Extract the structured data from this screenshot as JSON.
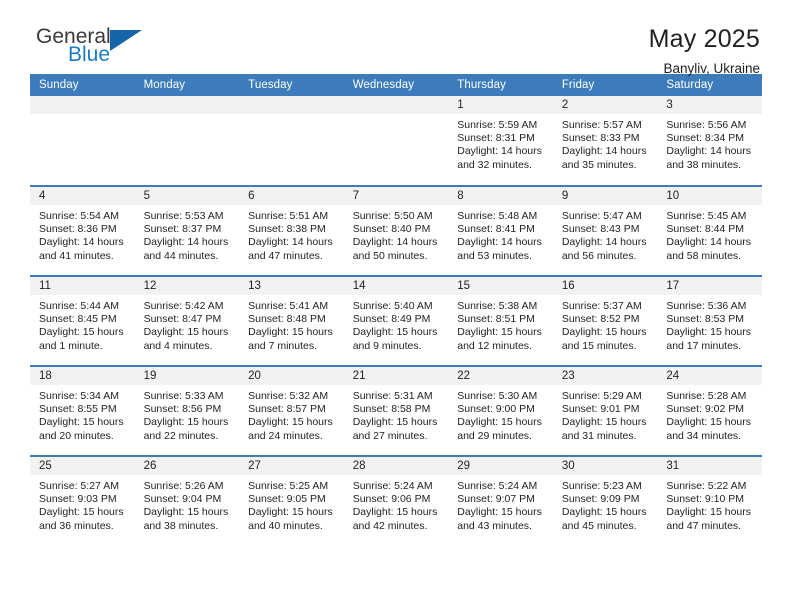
{
  "brand": {
    "name_top": "General",
    "name_bottom": "Blue",
    "flag_icon": "triangle-flag-icon",
    "accent_color": "#1d7dc4"
  },
  "header": {
    "title": "May 2025",
    "location": "Banyliv, Ukraine"
  },
  "theme": {
    "header_bg": "#3d7cba",
    "header_text": "#ffffff",
    "daynum_bg": "#f2f2f2",
    "cell_bg": "#ffffff",
    "text": "#231f20"
  },
  "weekday_headers": [
    "Sunday",
    "Monday",
    "Tuesday",
    "Wednesday",
    "Thursday",
    "Friday",
    "Saturday"
  ],
  "weeks": [
    [
      {
        "day": "",
        "sunrise": "",
        "sunset": "",
        "daylight": "",
        "daylight2": ""
      },
      {
        "day": "",
        "sunrise": "",
        "sunset": "",
        "daylight": "",
        "daylight2": ""
      },
      {
        "day": "",
        "sunrise": "",
        "sunset": "",
        "daylight": "",
        "daylight2": ""
      },
      {
        "day": "",
        "sunrise": "",
        "sunset": "",
        "daylight": "",
        "daylight2": ""
      },
      {
        "day": "1",
        "sunrise": "Sunrise: 5:59 AM",
        "sunset": "Sunset: 8:31 PM",
        "daylight": "Daylight: 14 hours",
        "daylight2": "and 32 minutes."
      },
      {
        "day": "2",
        "sunrise": "Sunrise: 5:57 AM",
        "sunset": "Sunset: 8:33 PM",
        "daylight": "Daylight: 14 hours",
        "daylight2": "and 35 minutes."
      },
      {
        "day": "3",
        "sunrise": "Sunrise: 5:56 AM",
        "sunset": "Sunset: 8:34 PM",
        "daylight": "Daylight: 14 hours",
        "daylight2": "and 38 minutes."
      }
    ],
    [
      {
        "day": "4",
        "sunrise": "Sunrise: 5:54 AM",
        "sunset": "Sunset: 8:36 PM",
        "daylight": "Daylight: 14 hours",
        "daylight2": "and 41 minutes."
      },
      {
        "day": "5",
        "sunrise": "Sunrise: 5:53 AM",
        "sunset": "Sunset: 8:37 PM",
        "daylight": "Daylight: 14 hours",
        "daylight2": "and 44 minutes."
      },
      {
        "day": "6",
        "sunrise": "Sunrise: 5:51 AM",
        "sunset": "Sunset: 8:38 PM",
        "daylight": "Daylight: 14 hours",
        "daylight2": "and 47 minutes."
      },
      {
        "day": "7",
        "sunrise": "Sunrise: 5:50 AM",
        "sunset": "Sunset: 8:40 PM",
        "daylight": "Daylight: 14 hours",
        "daylight2": "and 50 minutes."
      },
      {
        "day": "8",
        "sunrise": "Sunrise: 5:48 AM",
        "sunset": "Sunset: 8:41 PM",
        "daylight": "Daylight: 14 hours",
        "daylight2": "and 53 minutes."
      },
      {
        "day": "9",
        "sunrise": "Sunrise: 5:47 AM",
        "sunset": "Sunset: 8:43 PM",
        "daylight": "Daylight: 14 hours",
        "daylight2": "and 56 minutes."
      },
      {
        "day": "10",
        "sunrise": "Sunrise: 5:45 AM",
        "sunset": "Sunset: 8:44 PM",
        "daylight": "Daylight: 14 hours",
        "daylight2": "and 58 minutes."
      }
    ],
    [
      {
        "day": "11",
        "sunrise": "Sunrise: 5:44 AM",
        "sunset": "Sunset: 8:45 PM",
        "daylight": "Daylight: 15 hours",
        "daylight2": "and 1 minute."
      },
      {
        "day": "12",
        "sunrise": "Sunrise: 5:42 AM",
        "sunset": "Sunset: 8:47 PM",
        "daylight": "Daylight: 15 hours",
        "daylight2": "and 4 minutes."
      },
      {
        "day": "13",
        "sunrise": "Sunrise: 5:41 AM",
        "sunset": "Sunset: 8:48 PM",
        "daylight": "Daylight: 15 hours",
        "daylight2": "and 7 minutes."
      },
      {
        "day": "14",
        "sunrise": "Sunrise: 5:40 AM",
        "sunset": "Sunset: 8:49 PM",
        "daylight": "Daylight: 15 hours",
        "daylight2": "and 9 minutes."
      },
      {
        "day": "15",
        "sunrise": "Sunrise: 5:38 AM",
        "sunset": "Sunset: 8:51 PM",
        "daylight": "Daylight: 15 hours",
        "daylight2": "and 12 minutes."
      },
      {
        "day": "16",
        "sunrise": "Sunrise: 5:37 AM",
        "sunset": "Sunset: 8:52 PM",
        "daylight": "Daylight: 15 hours",
        "daylight2": "and 15 minutes."
      },
      {
        "day": "17",
        "sunrise": "Sunrise: 5:36 AM",
        "sunset": "Sunset: 8:53 PM",
        "daylight": "Daylight: 15 hours",
        "daylight2": "and 17 minutes."
      }
    ],
    [
      {
        "day": "18",
        "sunrise": "Sunrise: 5:34 AM",
        "sunset": "Sunset: 8:55 PM",
        "daylight": "Daylight: 15 hours",
        "daylight2": "and 20 minutes."
      },
      {
        "day": "19",
        "sunrise": "Sunrise: 5:33 AM",
        "sunset": "Sunset: 8:56 PM",
        "daylight": "Daylight: 15 hours",
        "daylight2": "and 22 minutes."
      },
      {
        "day": "20",
        "sunrise": "Sunrise: 5:32 AM",
        "sunset": "Sunset: 8:57 PM",
        "daylight": "Daylight: 15 hours",
        "daylight2": "and 24 minutes."
      },
      {
        "day": "21",
        "sunrise": "Sunrise: 5:31 AM",
        "sunset": "Sunset: 8:58 PM",
        "daylight": "Daylight: 15 hours",
        "daylight2": "and 27 minutes."
      },
      {
        "day": "22",
        "sunrise": "Sunrise: 5:30 AM",
        "sunset": "Sunset: 9:00 PM",
        "daylight": "Daylight: 15 hours",
        "daylight2": "and 29 minutes."
      },
      {
        "day": "23",
        "sunrise": "Sunrise: 5:29 AM",
        "sunset": "Sunset: 9:01 PM",
        "daylight": "Daylight: 15 hours",
        "daylight2": "and 31 minutes."
      },
      {
        "day": "24",
        "sunrise": "Sunrise: 5:28 AM",
        "sunset": "Sunset: 9:02 PM",
        "daylight": "Daylight: 15 hours",
        "daylight2": "and 34 minutes."
      }
    ],
    [
      {
        "day": "25",
        "sunrise": "Sunrise: 5:27 AM",
        "sunset": "Sunset: 9:03 PM",
        "daylight": "Daylight: 15 hours",
        "daylight2": "and 36 minutes."
      },
      {
        "day": "26",
        "sunrise": "Sunrise: 5:26 AM",
        "sunset": "Sunset: 9:04 PM",
        "daylight": "Daylight: 15 hours",
        "daylight2": "and 38 minutes."
      },
      {
        "day": "27",
        "sunrise": "Sunrise: 5:25 AM",
        "sunset": "Sunset: 9:05 PM",
        "daylight": "Daylight: 15 hours",
        "daylight2": "and 40 minutes."
      },
      {
        "day": "28",
        "sunrise": "Sunrise: 5:24 AM",
        "sunset": "Sunset: 9:06 PM",
        "daylight": "Daylight: 15 hours",
        "daylight2": "and 42 minutes."
      },
      {
        "day": "29",
        "sunrise": "Sunrise: 5:24 AM",
        "sunset": "Sunset: 9:07 PM",
        "daylight": "Daylight: 15 hours",
        "daylight2": "and 43 minutes."
      },
      {
        "day": "30",
        "sunrise": "Sunrise: 5:23 AM",
        "sunset": "Sunset: 9:09 PM",
        "daylight": "Daylight: 15 hours",
        "daylight2": "and 45 minutes."
      },
      {
        "day": "31",
        "sunrise": "Sunrise: 5:22 AM",
        "sunset": "Sunset: 9:10 PM",
        "daylight": "Daylight: 15 hours",
        "daylight2": "and 47 minutes."
      }
    ]
  ]
}
